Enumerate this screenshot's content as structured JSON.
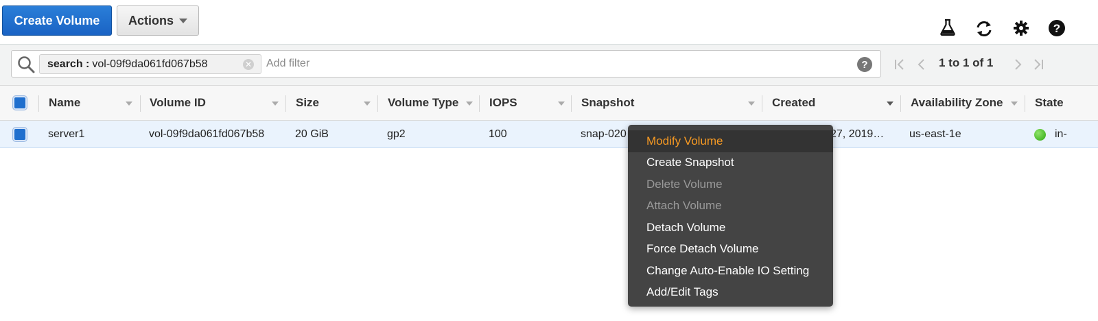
{
  "toolbar": {
    "create_label": "Create Volume",
    "actions_label": "Actions"
  },
  "top_icons": [
    "flask-icon",
    "refresh-icon",
    "gear-icon",
    "help-icon"
  ],
  "filter": {
    "token_key": "search :",
    "token_value": "vol-09f9da061fd067b58",
    "placeholder": "Add filter",
    "help_glyph": "?"
  },
  "pagination": {
    "text": "1 to 1 of 1"
  },
  "table": {
    "headers": {
      "name": "Name",
      "volume_id": "Volume ID",
      "size": "Size",
      "volume_type": "Volume Type",
      "iops": "IOPS",
      "snapshot": "Snapshot",
      "created": "Created",
      "availability_zone": "Availability Zone",
      "state": "State"
    },
    "rows": [
      {
        "name": "server1",
        "volume_id": "vol-09f9da061fd067b58",
        "size": "20 GiB",
        "volume_type": "gp2",
        "iops": "100",
        "snapshot": "snap-020",
        "created": "27, 2019…",
        "availability_zone": "us-east-1e",
        "state": "in-"
      }
    ]
  },
  "context_menu": {
    "items": [
      {
        "label": "Modify Volume",
        "state": "active"
      },
      {
        "label": "Create Snapshot",
        "state": "enabled"
      },
      {
        "label": "Delete Volume",
        "state": "disabled"
      },
      {
        "label": "Attach Volume",
        "state": "disabled"
      },
      {
        "label": "Detach Volume",
        "state": "enabled"
      },
      {
        "label": "Force Detach Volume",
        "state": "enabled"
      },
      {
        "label": "Change Auto-Enable IO Setting",
        "state": "enabled"
      },
      {
        "label": "Add/Edit Tags",
        "state": "enabled"
      }
    ]
  },
  "colors": {
    "primary": "#1f6fce",
    "menu_bg": "#444444",
    "menu_highlight": "#f79a23",
    "state_ok": "#2ea80f"
  }
}
